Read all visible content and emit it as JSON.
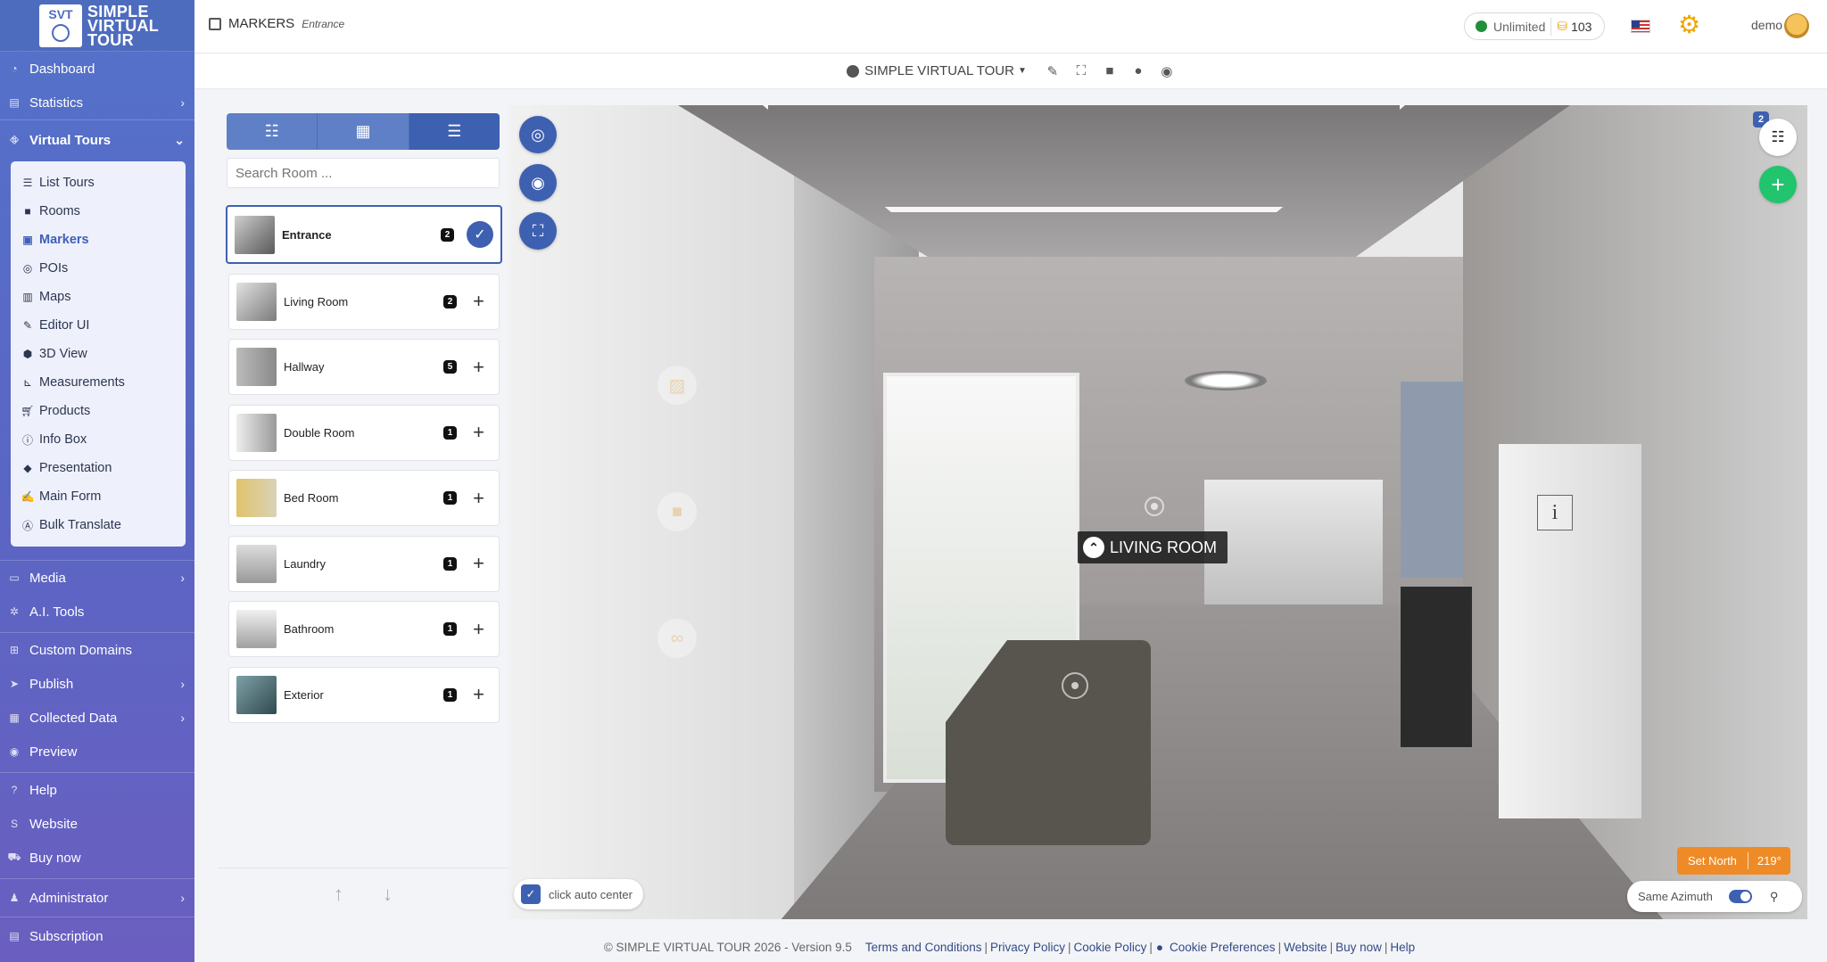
{
  "brand": {
    "badge": "SVT",
    "name_line1": "SIMPLE",
    "name_line2": "VIRTUAL",
    "name_line3": "TOUR"
  },
  "sidebar": {
    "items_top": [
      {
        "label": "Dashboard",
        "icon": "dashboard-icon"
      },
      {
        "label": "Statistics",
        "icon": "chart-icon"
      }
    ],
    "virtual_tours": {
      "label": "Virtual Tours",
      "icon": "tours-icon"
    },
    "submenu": [
      {
        "label": "List Tours",
        "icon": "list-icon"
      },
      {
        "label": "Rooms",
        "icon": "square-icon"
      },
      {
        "label": "Markers",
        "icon": "image-icon"
      },
      {
        "label": "POIs",
        "icon": "target-icon"
      },
      {
        "label": "Maps",
        "icon": "map-icon"
      },
      {
        "label": "Editor UI",
        "icon": "editor-icon"
      },
      {
        "label": "3D View",
        "icon": "cube-icon"
      },
      {
        "label": "Measurements",
        "icon": "ruler-icon"
      },
      {
        "label": "Products",
        "icon": "cart-icon"
      },
      {
        "label": "Info Box",
        "icon": "info-icon"
      },
      {
        "label": "Presentation",
        "icon": "diamond-icon"
      },
      {
        "label": "Main Form",
        "icon": "form-icon"
      },
      {
        "label": "Bulk Translate",
        "icon": "translate-icon"
      }
    ],
    "items_mid": [
      {
        "label": "Media",
        "icon": "media-icon"
      },
      {
        "label": "A.I. Tools",
        "icon": "ai-icon"
      }
    ],
    "items_domains": [
      {
        "label": "Custom Domains",
        "icon": "sitemap-icon"
      },
      {
        "label": "Publish",
        "icon": "send-icon"
      },
      {
        "label": "Collected Data",
        "icon": "data-icon"
      },
      {
        "label": "Preview",
        "icon": "eye-icon"
      }
    ],
    "items_help": [
      {
        "label": "Help",
        "icon": "help-icon"
      },
      {
        "label": "Website",
        "icon": "website-icon"
      },
      {
        "label": "Buy now",
        "icon": "cart-icon"
      }
    ],
    "items_admin": [
      {
        "label": "Administrator",
        "icon": "admin-icon"
      }
    ],
    "items_sub": [
      {
        "label": "Subscription",
        "icon": "subscription-icon"
      }
    ]
  },
  "topbar": {
    "section": "MARKERS",
    "room": "Entrance",
    "plan": "Unlimited",
    "credits": "103",
    "user": "demo"
  },
  "subbar": {
    "tour_name": "SIMPLE VIRTUAL TOUR"
  },
  "rooms_panel": {
    "search_placeholder": "Search Room ...",
    "rooms": [
      {
        "name": "Entrance",
        "count": "2",
        "selected": true
      },
      {
        "name": "Living Room",
        "count": "2"
      },
      {
        "name": "Hallway",
        "count": "5"
      },
      {
        "name": "Double Room",
        "count": "1"
      },
      {
        "name": "Bed Room",
        "count": "1"
      },
      {
        "name": "Laundry",
        "count": "1"
      },
      {
        "name": "Bathroom",
        "count": "1"
      },
      {
        "name": "Exterior",
        "count": "1"
      }
    ]
  },
  "viewer": {
    "marker_label": "LIVING ROOM",
    "info_label": "i",
    "list_badge": "2",
    "auto_center": "click auto center",
    "set_north": "Set North",
    "degrees": "219°",
    "same_azimuth": "Same Azimuth"
  },
  "footer": {
    "copyright": "© SIMPLE VIRTUAL TOUR 2026 - Version 9.5",
    "links": [
      "Terms and Conditions",
      "Privacy Policy",
      "Cookie Policy",
      "Cookie Preferences",
      "Website",
      "Buy now",
      "Help"
    ]
  },
  "colors": {
    "primary": "#3e60b0",
    "sidebar": "#5a66c4",
    "success": "#22c46d",
    "warning": "#ef8b26"
  }
}
